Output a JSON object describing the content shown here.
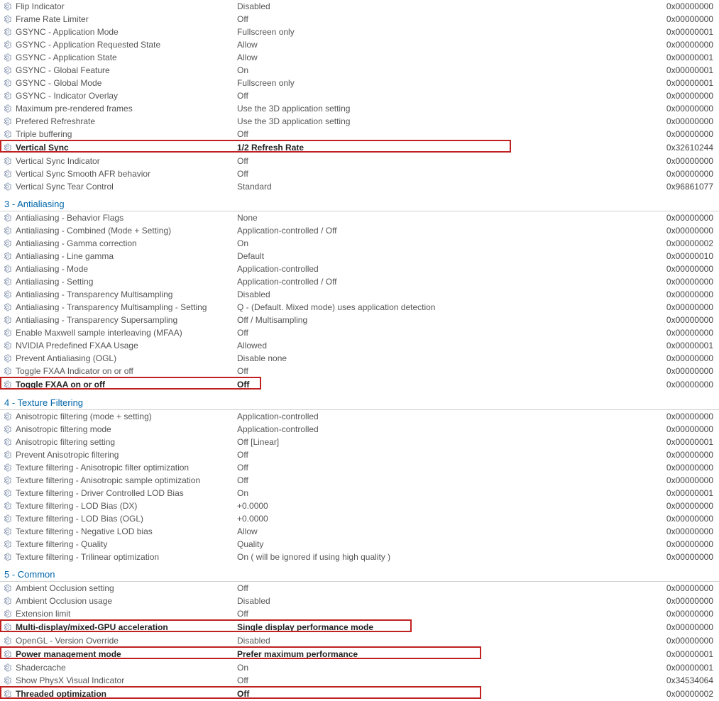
{
  "sections": [
    {
      "id": "sync",
      "title": null,
      "rows": [
        {
          "label": "Flip Indicator",
          "value": "Disabled",
          "hex": "0x00000000",
          "hl": false,
          "lw": 0
        },
        {
          "label": "Frame Rate Limiter",
          "value": "Off",
          "hex": "0x00000000",
          "hl": false,
          "lw": 0
        },
        {
          "label": "GSYNC - Application Mode",
          "value": "Fullscreen only",
          "hex": "0x00000001",
          "hl": false,
          "lw": 0
        },
        {
          "label": "GSYNC - Application Requested State",
          "value": "Allow",
          "hex": "0x00000000",
          "hl": false,
          "lw": 0
        },
        {
          "label": "GSYNC - Application State",
          "value": "Allow",
          "hex": "0x00000001",
          "hl": false,
          "lw": 0
        },
        {
          "label": "GSYNC - Global Feature",
          "value": "On",
          "hex": "0x00000001",
          "hl": false,
          "lw": 0
        },
        {
          "label": "GSYNC - Global Mode",
          "value": "Fullscreen only",
          "hex": "0x00000001",
          "hl": false,
          "lw": 0
        },
        {
          "label": "GSYNC - Indicator Overlay",
          "value": "Off",
          "hex": "0x00000000",
          "hl": false,
          "lw": 0
        },
        {
          "label": "Maximum pre-rendered frames",
          "value": "Use the 3D application setting",
          "hex": "0x00000000",
          "hl": false,
          "lw": 0
        },
        {
          "label": "Prefered Refreshrate",
          "value": "Use the 3D application setting",
          "hex": "0x00000000",
          "hl": false,
          "lw": 0
        },
        {
          "label": "Triple buffering",
          "value": "Off",
          "hex": "0x00000000",
          "hl": false,
          "lw": 0
        },
        {
          "label": "Vertical Sync",
          "value": "1/2 Refresh Rate",
          "hex": "0x32610244",
          "hl": true,
          "lw": 720
        },
        {
          "label": "Vertical Sync Indicator",
          "value": "Off",
          "hex": "0x00000000",
          "hl": false,
          "lw": 0
        },
        {
          "label": "Vertical Sync Smooth AFR behavior",
          "value": "Off",
          "hex": "0x00000000",
          "hl": false,
          "lw": 0
        },
        {
          "label": "Vertical Sync Tear Control",
          "value": "Standard",
          "hex": "0x96861077",
          "hl": false,
          "lw": 0
        }
      ]
    },
    {
      "id": "antialiasing",
      "title": "3 - Antialiasing",
      "rows": [
        {
          "label": "Antialiasing - Behavior Flags",
          "value": "None",
          "hex": "0x00000000",
          "hl": false,
          "lw": 0
        },
        {
          "label": "Antialiasing - Combined (Mode + Setting)",
          "value": "Application-controlled / Off",
          "hex": "0x00000000",
          "hl": false,
          "lw": 0
        },
        {
          "label": "Antialiasing - Gamma correction",
          "value": "On",
          "hex": "0x00000002",
          "hl": false,
          "lw": 0
        },
        {
          "label": "Antialiasing - Line gamma",
          "value": "Default",
          "hex": "0x00000010",
          "hl": false,
          "lw": 0
        },
        {
          "label": "Antialiasing - Mode",
          "value": "Application-controlled",
          "hex": "0x00000000",
          "hl": false,
          "lw": 0
        },
        {
          "label": "Antialiasing - Setting",
          "value": "Application-controlled / Off",
          "hex": "0x00000000",
          "hl": false,
          "lw": 0
        },
        {
          "label": "Antialiasing - Transparency Multisampling",
          "value": "Disabled",
          "hex": "0x00000000",
          "hl": false,
          "lw": 0
        },
        {
          "label": "Antialiasing - Transparency Multisampling - Setting",
          "value": "Q - (Default. Mixed mode) uses application detection",
          "hex": "0x00000000",
          "hl": false,
          "lw": 0
        },
        {
          "label": "Antialiasing - Transparency Supersampling",
          "value": "Off / Multisampling",
          "hex": "0x00000000",
          "hl": false,
          "lw": 0
        },
        {
          "label": "Enable Maxwell sample interleaving (MFAA)",
          "value": "Off",
          "hex": "0x00000000",
          "hl": false,
          "lw": 0
        },
        {
          "label": "NVIDIA Predefined FXAA Usage",
          "value": "Allowed",
          "hex": "0x00000001",
          "hl": false,
          "lw": 0
        },
        {
          "label": "Prevent Antialiasing (OGL)",
          "value": "Disable none",
          "hex": "0x00000000",
          "hl": false,
          "lw": 0
        },
        {
          "label": "Toggle FXAA Indicator on or off",
          "value": "Off",
          "hex": "0x00000000",
          "hl": false,
          "lw": 0
        },
        {
          "label": "Toggle FXAA on or off",
          "value": "Off",
          "hex": "0x00000000",
          "hl": true,
          "lw": 368
        }
      ]
    },
    {
      "id": "texture",
      "title": "4 - Texture Filtering",
      "rows": [
        {
          "label": "Anisotropic filtering (mode + setting)",
          "value": "Application-controlled",
          "hex": "0x00000000",
          "hl": false,
          "lw": 0
        },
        {
          "label": "Anisotropic filtering mode",
          "value": "Application-controlled",
          "hex": "0x00000000",
          "hl": false,
          "lw": 0
        },
        {
          "label": "Anisotropic filtering setting",
          "value": "Off [Linear]",
          "hex": "0x00000001",
          "hl": false,
          "lw": 0
        },
        {
          "label": "Prevent Anisotropic filtering",
          "value": "Off",
          "hex": "0x00000000",
          "hl": false,
          "lw": 0
        },
        {
          "label": "Texture filtering - Anisotropic filter optimization",
          "value": "Off",
          "hex": "0x00000000",
          "hl": false,
          "lw": 0
        },
        {
          "label": "Texture filtering - Anisotropic sample optimization",
          "value": "Off",
          "hex": "0x00000000",
          "hl": false,
          "lw": 0
        },
        {
          "label": "Texture filtering - Driver Controlled LOD Bias",
          "value": "On",
          "hex": "0x00000001",
          "hl": false,
          "lw": 0
        },
        {
          "label": "Texture filtering - LOD Bias (DX)",
          "value": "+0.0000",
          "hex": "0x00000000",
          "hl": false,
          "lw": 0
        },
        {
          "label": "Texture filtering - LOD Bias (OGL)",
          "value": "+0.0000",
          "hex": "0x00000000",
          "hl": false,
          "lw": 0
        },
        {
          "label": "Texture filtering - Negative LOD bias",
          "value": "Allow",
          "hex": "0x00000000",
          "hl": false,
          "lw": 0
        },
        {
          "label": "Texture filtering - Quality",
          "value": "Quality",
          "hex": "0x00000000",
          "hl": false,
          "lw": 0
        },
        {
          "label": "Texture filtering - Trilinear optimization",
          "value": "On ( will be ignored if using high quality )",
          "hex": "0x00000000",
          "hl": false,
          "lw": 0
        }
      ]
    },
    {
      "id": "common",
      "title": "5 - Common",
      "rows": [
        {
          "label": "Ambient Occlusion setting",
          "value": "Off",
          "hex": "0x00000000",
          "hl": false,
          "lw": 0
        },
        {
          "label": "Ambient Occlusion usage",
          "value": "Disabled",
          "hex": "0x00000000",
          "hl": false,
          "lw": 0
        },
        {
          "label": "Extension limit",
          "value": "Off",
          "hex": "0x00000000",
          "hl": false,
          "lw": 0
        },
        {
          "label": "Multi-display/mixed-GPU acceleration",
          "value": "Single display performance mode",
          "hex": "0x00000000",
          "hl": true,
          "lw": 580
        },
        {
          "label": "OpenGL - Version Override",
          "value": "Disabled",
          "hex": "0x00000000",
          "hl": false,
          "lw": 0
        },
        {
          "label": "Power management mode",
          "value": "Prefer maximum performance",
          "hex": "0x00000001",
          "hl": true,
          "lw": 678
        },
        {
          "label": "Shadercache",
          "value": "On",
          "hex": "0x00000001",
          "hl": false,
          "lw": 0
        },
        {
          "label": "Show PhysX Visual Indicator",
          "value": "Off",
          "hex": "0x34534064",
          "hl": false,
          "lw": 0
        },
        {
          "label": "Threaded optimization",
          "value": "Off",
          "hex": "0x00000002",
          "hl": true,
          "lw": 678
        }
      ]
    }
  ]
}
